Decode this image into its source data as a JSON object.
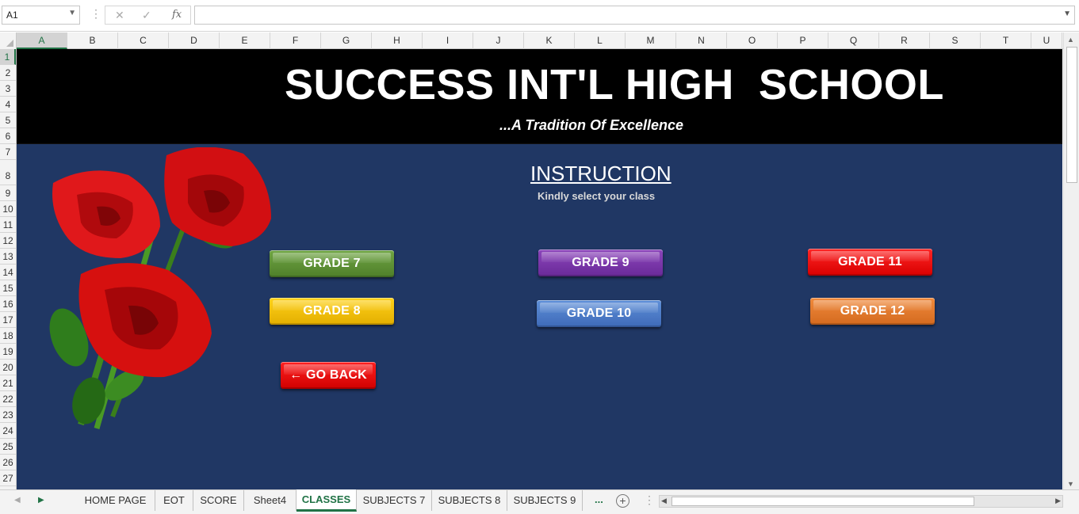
{
  "formula_bar": {
    "name_box": "A1",
    "cancel_icon": "✕",
    "enter_icon": "✓",
    "function_label": "fx",
    "formula_value": ""
  },
  "columns": [
    "A",
    "B",
    "C",
    "D",
    "E",
    "F",
    "G",
    "H",
    "I",
    "J",
    "K",
    "L",
    "M",
    "N",
    "O",
    "P",
    "Q",
    "R",
    "S",
    "T",
    "U"
  ],
  "rows": [
    "1",
    "2",
    "3",
    "4",
    "5",
    "6",
    "7",
    "8",
    "9",
    "10",
    "11",
    "12",
    "13",
    "14",
    "15",
    "16",
    "17",
    "18",
    "19",
    "20",
    "21",
    "22",
    "23",
    "24",
    "25",
    "26",
    "27"
  ],
  "header": {
    "title": "SUCCESS INT'L HIGH  SCHOOL",
    "tagline": "...A Tradition Of Excellence"
  },
  "instruction": {
    "title": "INSTRUCTION",
    "text": "Kindly select your class"
  },
  "buttons": {
    "grade_7": "GRADE 7",
    "grade_8": "GRADE 8",
    "grade_9": "GRADE 9",
    "grade_10": "GRADE 10",
    "grade_11": "GRADE 11",
    "grade_12": "GRADE 12",
    "go_back": "← GO BACK"
  },
  "tabs": [
    {
      "label": "HOME PAGE"
    },
    {
      "label": "EOT"
    },
    {
      "label": "SCORE"
    },
    {
      "label": "Sheet4"
    },
    {
      "label": "CLASSES"
    },
    {
      "label": "SUBJECTS 7"
    },
    {
      "label": "SUBJECTS 8"
    },
    {
      "label": "SUBJECTS 9"
    }
  ],
  "active_tab": "CLASSES",
  "tab_overflow": "...",
  "colors": {
    "sheet_background": "#203764",
    "banner": "#000000",
    "accent": "#217346"
  }
}
